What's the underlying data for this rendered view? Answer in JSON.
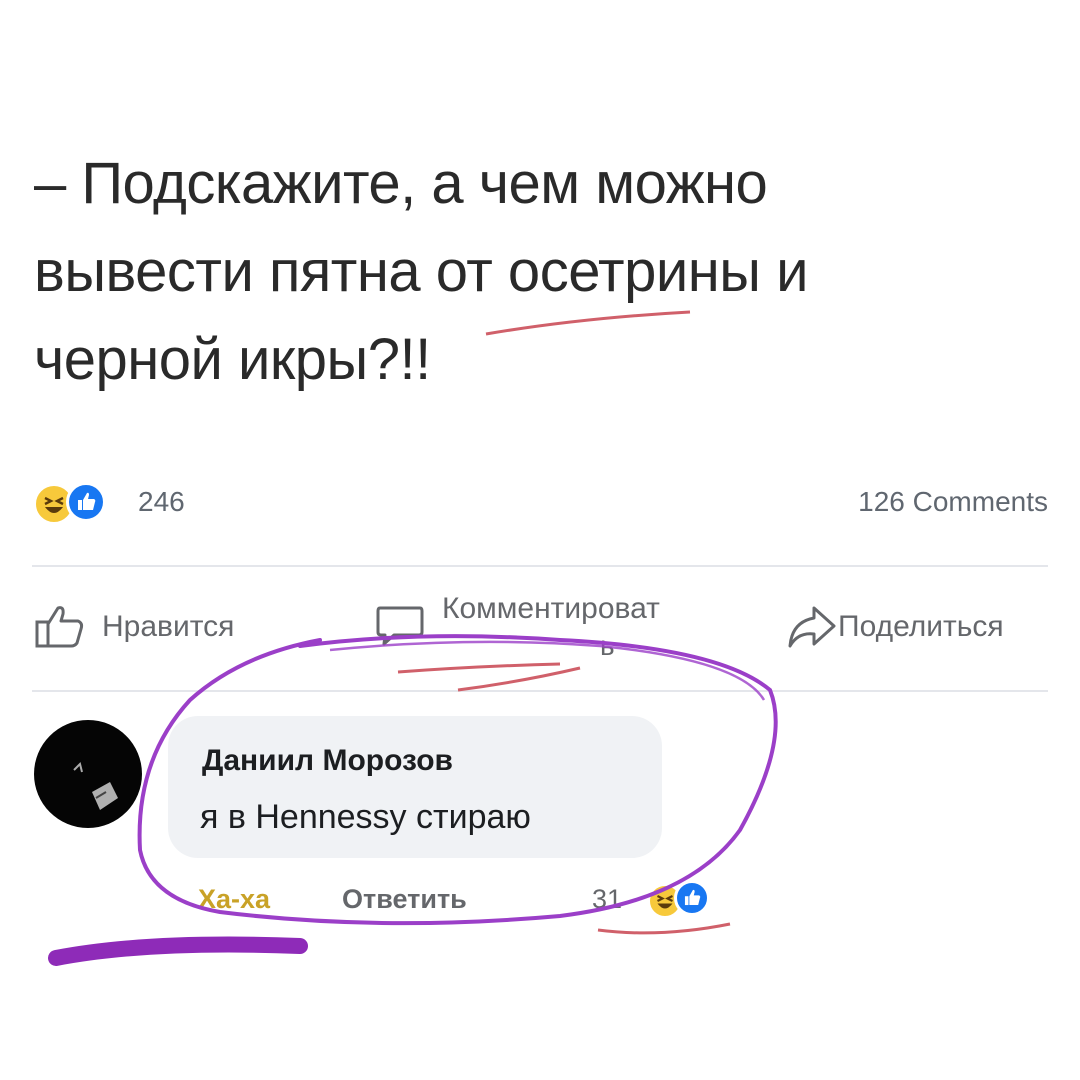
{
  "post": {
    "lines": [
      "– Подскажите, а чем можно",
      "вывести пятна от осетрины и",
      "черной икры?!!"
    ]
  },
  "reactions": {
    "count": "246",
    "icons": [
      "haha-emoji",
      "like-emoji"
    ]
  },
  "comments_count": "126 Comments",
  "actions": {
    "like": "Нравится",
    "comment": "Комментироват",
    "comment_overflow": "ь",
    "share": "Поделиться"
  },
  "comment": {
    "author": "Даниил Морозов",
    "text": "я в Hennessy стираю",
    "haha_label": "Ха-ха",
    "reply_label": "Ответить",
    "reaction_count": "31",
    "reaction_icons": [
      "haha-emoji",
      "like-emoji"
    ]
  },
  "colors": {
    "like_blue": "#1877f2",
    "haha_yellow": "#f7c93b",
    "muted_text": "#65676b",
    "bubble_bg": "#f0f2f5",
    "marker_purple": "#9b3fc8",
    "underline_red": "#d0606a"
  }
}
